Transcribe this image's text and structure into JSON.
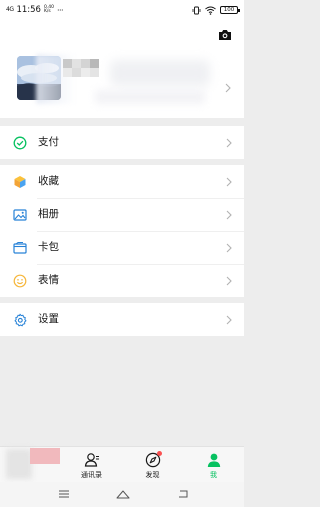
{
  "status_bar": {
    "signal": "4G",
    "time": "11:56",
    "network_speed": "0.40 K/s",
    "more": "···",
    "battery": "100"
  },
  "menu": {
    "payment": "支付",
    "favorites": "收藏",
    "album": "相册",
    "cards": "卡包",
    "stickers": "表情",
    "settings": "设置"
  },
  "tabs": [
    {
      "label": "通讯录",
      "icon": "contacts-icon"
    },
    {
      "label": "发现",
      "icon": "discover-icon"
    },
    {
      "label": "我",
      "icon": "me-icon"
    }
  ],
  "colors": {
    "accent": "#07c160",
    "badge": "#fa5151",
    "background": "#ededed"
  }
}
